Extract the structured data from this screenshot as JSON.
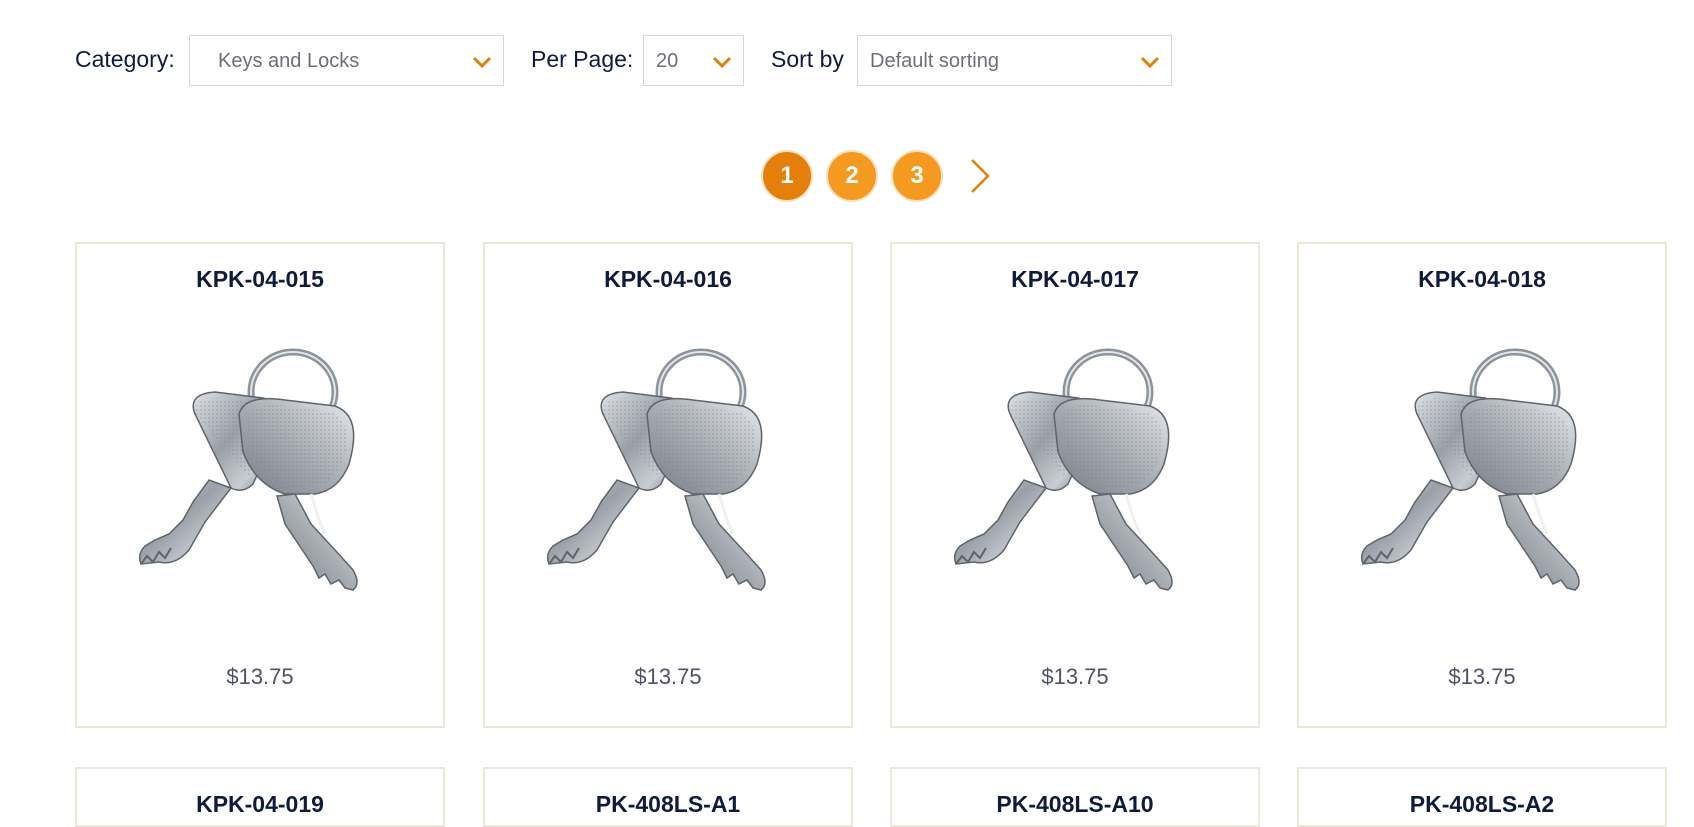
{
  "filters": {
    "category_label": "Category:",
    "category_value": "Keys and Locks",
    "perpage_label": "Per Page:",
    "perpage_value": "20",
    "sort_label": "Sort by",
    "sort_value": "Default sorting",
    "accent_color": "#e37f0a"
  },
  "pagination": {
    "pages": [
      "1",
      "2",
      "3"
    ],
    "current": "1",
    "next_icon": "chevron-right-icon"
  },
  "products": [
    {
      "sku": "KPK-04-015",
      "price": "$13.75",
      "image": "key-pair-image"
    },
    {
      "sku": "KPK-04-016",
      "price": "$13.75",
      "image": "key-pair-image"
    },
    {
      "sku": "KPK-04-017",
      "price": "$13.75",
      "image": "key-pair-image"
    },
    {
      "sku": "KPK-04-018",
      "price": "$13.75",
      "image": "key-pair-image"
    },
    {
      "sku": "KPK-04-019"
    },
    {
      "sku": "PK-408LS-A1"
    },
    {
      "sku": "PK-408LS-A10"
    },
    {
      "sku": "PK-408LS-A2"
    }
  ]
}
